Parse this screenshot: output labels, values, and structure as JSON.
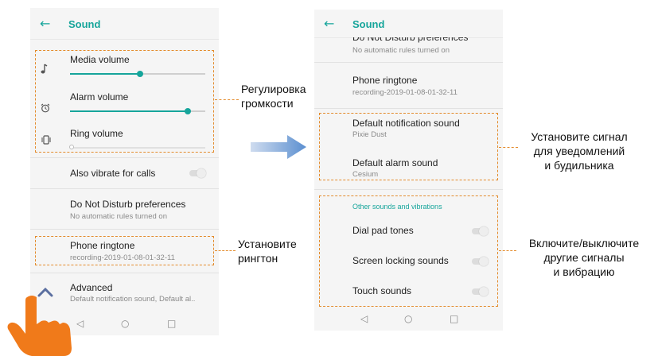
{
  "left_screen": {
    "title": "Sound",
    "volumes": [
      {
        "label": "Media volume",
        "icon": "music-note-icon",
        "level": 0.52
      },
      {
        "label": "Alarm volume",
        "icon": "alarm-clock-icon",
        "level": 0.87
      },
      {
        "label": "Ring volume",
        "icon": "vibrate-icon",
        "level": 0.0
      }
    ],
    "also_vibrate": "Also vibrate for calls",
    "dnd_title": "Do Not Disturb preferences",
    "dnd_sub": "No automatic rules turned on",
    "ringtone_title": "Phone ringtone",
    "ringtone_sub": "recording-2019-01-08-01-32-11",
    "advanced_title": "Advanced",
    "advanced_sub": "Default notification sound, Default al.."
  },
  "right_screen": {
    "title": "Sound",
    "dnd_title": "Do Not Disturb preferences",
    "dnd_sub": "No automatic rules turned on",
    "ringtone_title": "Phone ringtone",
    "ringtone_sub": "recording-2019-01-08-01-32-11",
    "notif_title": "Default notification sound",
    "notif_sub": "Pixie Dust",
    "alarm_title": "Default alarm sound",
    "alarm_sub": "Cesium",
    "other_header": "Other sounds and vibrations",
    "other_items": [
      "Dial pad tones",
      "Screen locking sounds",
      "Touch sounds"
    ]
  },
  "nav": {
    "back": "◁",
    "home": "○",
    "recents": "□"
  },
  "callouts": {
    "volume": [
      "Регулировка",
      "громкости"
    ],
    "ringtone": [
      "Установите",
      "рингтон"
    ],
    "notif_alarm": [
      "Установите сигнал",
      "для уведомлений",
      "и будильника"
    ],
    "other": [
      "Включите/выключите",
      "другие сигналы",
      "и вибрацию"
    ]
  },
  "colors": {
    "accent": "#16a59b",
    "highlight": "#e38b2c",
    "arrow": "#5b8fd0"
  }
}
